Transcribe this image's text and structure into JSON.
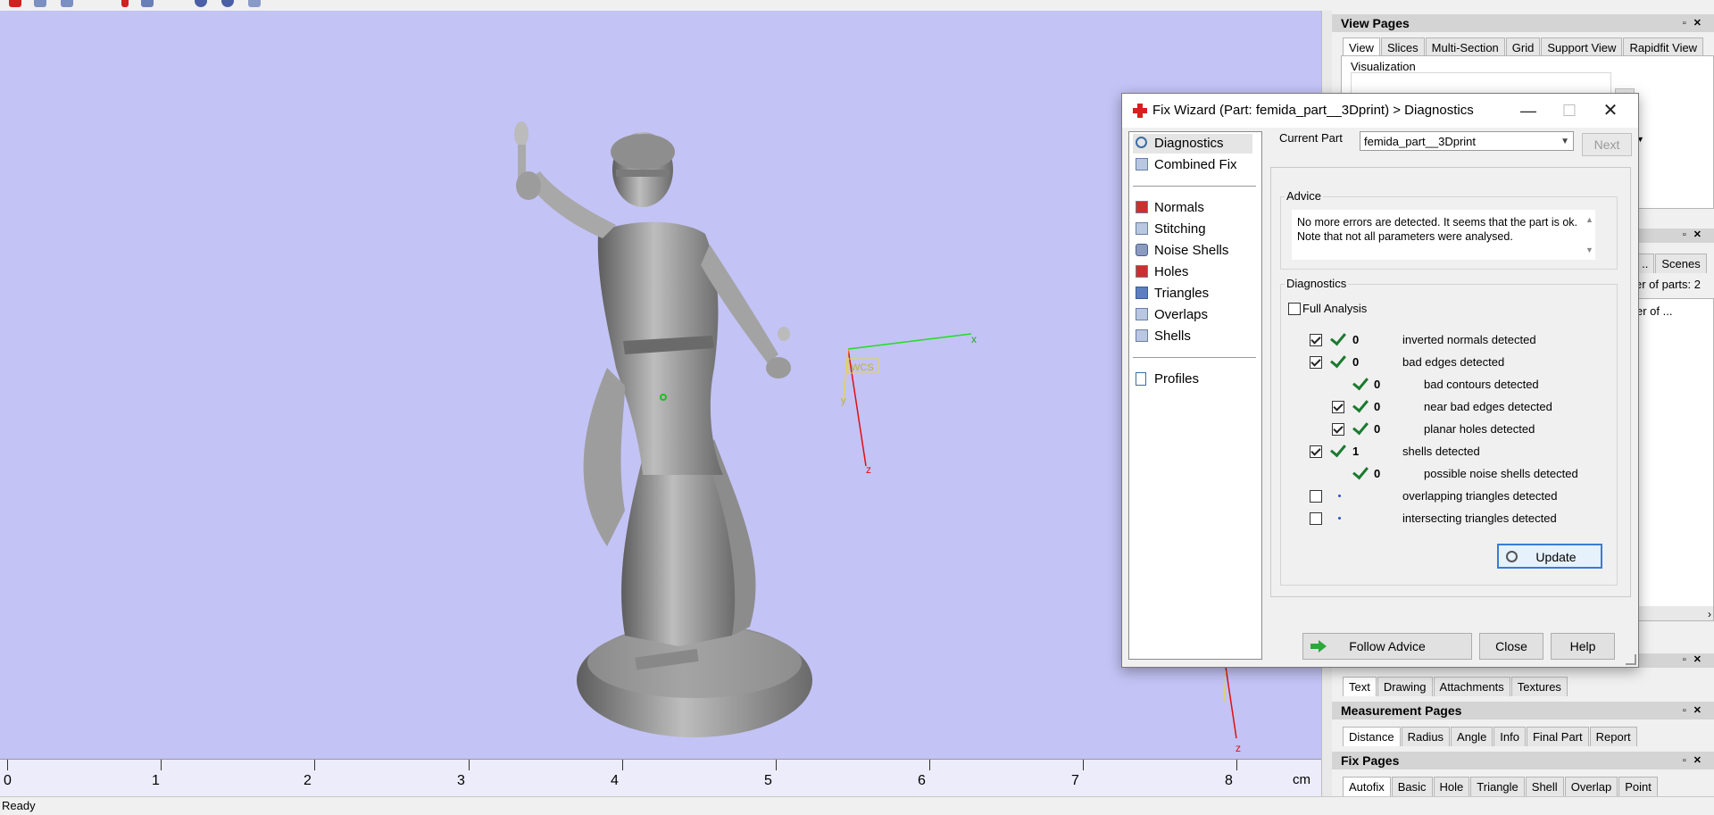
{
  "viewport": {
    "axis_x_label": "x",
    "axis_y_label": "y",
    "axis_z_label": "z",
    "wcs_label": "WCS",
    "z_marker_label": "z",
    "ruler_labels": [
      "0",
      "1",
      "2",
      "3",
      "4",
      "5",
      "6",
      "7",
      "8"
    ],
    "ruler_unit": "cm"
  },
  "status": "Ready",
  "panel_view": {
    "title": "View Pages",
    "tabs": [
      "View",
      "Slices",
      "Multi-Section",
      "Grid",
      "Support View",
      "Rapidfit View"
    ],
    "group_label": "Visualization"
  },
  "panel_parts": {
    "tabs": [
      "s ..",
      "Scenes"
    ],
    "count_text": "er of parts: 2",
    "item_text": "er of ..."
  },
  "panel_text": {
    "tabs": [
      "Text",
      "Drawing",
      "Attachments",
      "Textures"
    ]
  },
  "panel_measure": {
    "title": "Measurement Pages",
    "tabs": [
      "Distance",
      "Radius",
      "Angle",
      "Info",
      "Final Part",
      "Report"
    ]
  },
  "panel_fix": {
    "title": "Fix Pages",
    "tabs": [
      "Autofix",
      "Basic",
      "Hole",
      "Triangle",
      "Shell",
      "Overlap",
      "Point"
    ]
  },
  "dialog": {
    "title": "Fix Wizard (Part: femida_part__3Dprint) > Diagnostics",
    "nav_top": [
      "Diagnostics",
      "Combined Fix"
    ],
    "nav_mid": [
      "Normals",
      "Stitching",
      "Noise Shells",
      "Holes",
      "Triangles",
      "Overlaps",
      "Shells"
    ],
    "nav_bottom": [
      "Profiles"
    ],
    "current_part_label": "Current Part",
    "current_part_value": "femida_part__3Dprint",
    "next_label": "Next",
    "advice_title": "Advice",
    "advice_text": "No more errors are detected. It seems that the part is ok. Note that not all parameters were analysed.",
    "diagnostics_title": "Diagnostics",
    "full_analysis_label": "Full Analysis",
    "rows": [
      {
        "count": "0",
        "text": "inverted normals detected"
      },
      {
        "count": "0",
        "text": "bad edges detected"
      },
      {
        "count": "0",
        "text": "bad contours detected"
      },
      {
        "count": "0",
        "text": "near bad edges detected"
      },
      {
        "count": "0",
        "text": "planar holes detected"
      },
      {
        "count": "1",
        "text": "shells detected"
      },
      {
        "count": "0",
        "text": "possible noise shells detected"
      },
      {
        "count": "",
        "text": "overlapping triangles detected"
      },
      {
        "count": "",
        "text": "intersecting triangles detected"
      }
    ],
    "update_label": "Update",
    "follow_advice_label": "Follow Advice",
    "close_label": "Close",
    "help_label": "Help"
  },
  "colors": {
    "viewport_bg": "#c3c3f5",
    "check_green": "#1a7a2e",
    "axis_x": "#22dd22",
    "axis_y": "#e01010",
    "wcs_yellow": "#e6d44a"
  }
}
